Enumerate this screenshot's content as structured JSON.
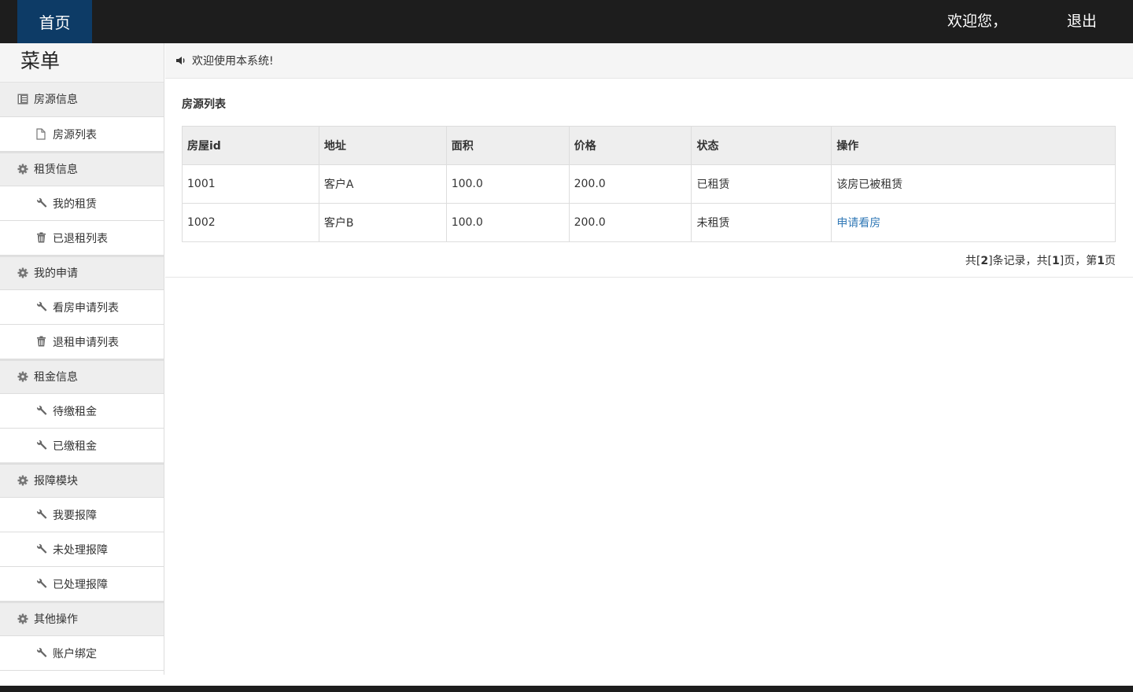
{
  "topbar": {
    "home_label": "首页",
    "welcome_text": "欢迎您，",
    "logout_label": "退出"
  },
  "sidebar": {
    "title": "菜单",
    "groups": [
      {
        "label": "房源信息",
        "icon": "list-icon",
        "items": [
          {
            "label": "房源列表",
            "icon": "file-icon"
          }
        ]
      },
      {
        "label": "租赁信息",
        "icon": "gear-icon",
        "items": [
          {
            "label": "我的租赁",
            "icon": "wrench-icon"
          },
          {
            "label": "已退租列表",
            "icon": "trash-icon"
          }
        ]
      },
      {
        "label": "我的申请",
        "icon": "gear-icon",
        "items": [
          {
            "label": "看房申请列表",
            "icon": "wrench-icon"
          },
          {
            "label": "退租申请列表",
            "icon": "trash-icon"
          }
        ]
      },
      {
        "label": "租金信息",
        "icon": "gear-icon",
        "items": [
          {
            "label": "待缴租金",
            "icon": "wrench-icon"
          },
          {
            "label": "已缴租金",
            "icon": "wrench-icon"
          }
        ]
      },
      {
        "label": "报障模块",
        "icon": "gear-icon",
        "items": [
          {
            "label": "我要报障",
            "icon": "wrench-icon"
          },
          {
            "label": "未处理报障",
            "icon": "wrench-icon"
          },
          {
            "label": "已处理报障",
            "icon": "wrench-icon"
          }
        ]
      },
      {
        "label": "其他操作",
        "icon": "gear-icon",
        "items": [
          {
            "label": "账户绑定",
            "icon": "wrench-icon"
          }
        ]
      }
    ]
  },
  "notice": {
    "icon": "volume-icon",
    "text": "欢迎使用本系统!"
  },
  "panel": {
    "title": "房源列表",
    "columns": [
      "房屋id",
      "地址",
      "面积",
      "价格",
      "状态",
      "操作"
    ],
    "rows": [
      {
        "id": "1001",
        "address": "客户A",
        "area": "100.0",
        "price": "200.0",
        "status": "已租赁",
        "action": "该房已被租赁",
        "action_link": false
      },
      {
        "id": "1002",
        "address": "客户B",
        "area": "100.0",
        "price": "200.0",
        "status": "未租赁",
        "action": "申请看房",
        "action_link": true
      }
    ],
    "pager": {
      "prefix": "共[",
      "total_records": "2",
      "mid1": "]条记录，共[",
      "total_pages": "1",
      "mid2": "]页，第",
      "current_page": "1",
      "suffix": "页"
    }
  },
  "colors": {
    "topbar_bg": "#1d1d1d",
    "home_bg": "#0d3b66",
    "link": "#337ab7"
  }
}
